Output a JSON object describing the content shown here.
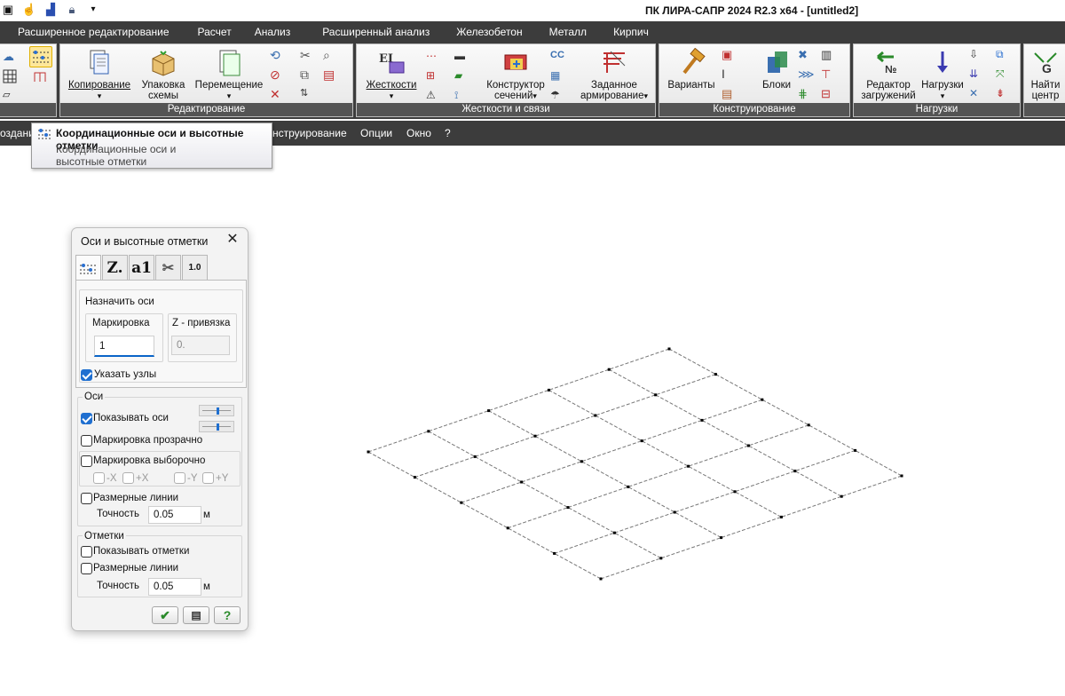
{
  "app": {
    "title": "ПК ЛИРА-САПР  2024 R2.3 x64 - [untitled2]"
  },
  "tabs": [
    "Расширенное редактирование",
    "Расчет",
    "Анализ",
    "Расширенный анализ",
    "Железобетон",
    "Металл",
    "Кирпич"
  ],
  "ribbon": {
    "groups": {
      "edit": "Редактирование",
      "stiff": "Жесткости и связи",
      "design": "Конструирование",
      "loads": "Нагрузки"
    },
    "buttons": {
      "copy": "Копирование",
      "pack1": "Упаковка",
      "pack2": "схемы",
      "move": "Перемещение",
      "stiffness": "Жесткости",
      "sect1": "Конструктор",
      "sect2": "сечений",
      "reinf1": "Заданное",
      "reinf2": "армирование",
      "variants": "Варианты",
      "blocks": "Блоки",
      "editor1": "Редактор",
      "editor2": "загружений",
      "loads": "Нагрузки",
      "find1": "Найти",
      "find2": "центр"
    }
  },
  "menubar": {
    "partial_left": "оздани",
    "partial_design": "нструирование",
    "options": "Опции",
    "window": "Окно",
    "help": "?"
  },
  "tooltip": {
    "title": "Координационные оси и высотные отметки",
    "body": "Координационные оси и высотные отметки"
  },
  "dialog": {
    "title": "Оси и высотные отметки",
    "tabs": [
      "axes",
      "Z.",
      "a1",
      "cut",
      "1.0"
    ],
    "assign": {
      "legend": "Назначить оси",
      "marking_label": "Маркировка",
      "marking_value": "1",
      "z_label": "Z - привязка",
      "z_value": "0.",
      "specify_nodes": "Указать узлы"
    },
    "axes": {
      "legend": "Оси",
      "show_axes": "Показывать оси",
      "transparent": "Маркировка прозрачно",
      "selective": "Маркировка выборочно",
      "dirs": [
        "-X",
        "+X",
        "-Y",
        "+Y"
      ],
      "dim_lines": "Размерные линии",
      "precision_label": "Точность",
      "precision_value": "0.05",
      "unit": "м"
    },
    "marks": {
      "legend": "Отметки",
      "show_marks": "Показывать отметки",
      "dim_lines": "Размерные линии",
      "precision_label": "Точность",
      "precision_value": "0.05",
      "unit": "м"
    },
    "checks": {
      "specify_nodes": true,
      "show_axes": true,
      "transparent": false,
      "selective": false,
      "dim_lines_axes": false,
      "show_marks": false,
      "dim_lines_marks": false
    }
  },
  "grid": {
    "rows": 6,
    "cols": 6
  }
}
